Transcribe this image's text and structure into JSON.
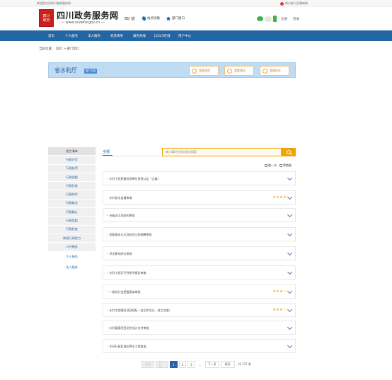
{
  "topbar": {
    "welcome": "欢迎您访问四川政务服务网",
    "login_link": "四川省人民政府网"
  },
  "header": {
    "seal_text": "四川政务",
    "site_title": "四川政务服务网",
    "site_url": "— www.sczwfw.gov.cn —",
    "province": "四川省",
    "site_switch": "站点切换",
    "dept_window": "部门窗口",
    "register": "注册",
    "login": "登录"
  },
  "nav": {
    "items": [
      "首页",
      "个人服务",
      "法人服务",
      "权责清单",
      "服务热线",
      "12345在线",
      "用户中心"
    ]
  },
  "breadcrumb": "当前位置： 首页 > 部门窗口",
  "banner": {
    "dept_name": "省水利厅",
    "tag": "部门介绍",
    "buttons": [
      "我要咨询",
      "我要建议",
      "我要投诉"
    ]
  },
  "sidebar": {
    "items": [
      "权力清单",
      "行政许可",
      "行政处罚",
      "行政强制",
      "行政征收",
      "行政给付",
      "行政裁决",
      "行政确认",
      "行政奖励",
      "行政检查",
      "其他行政权力",
      "公共服务"
    ],
    "extra": [
      "个人服务",
      "法人服务"
    ]
  },
  "content": {
    "tab_label": "全部",
    "search_placeholder": "输入事项名称关键字搜索",
    "filters": [
      "跑一次",
      "零跑腿"
    ],
    "items": [
      {
        "title": "水利工程质量检测单位资质认定（乙级）",
        "stars": ""
      },
      {
        "title": "水利安全监督审查",
        "stars": "★★★★"
      },
      {
        "title": "市级水文测站的审批",
        "stars": ""
      },
      {
        "title": "国家基本水文测站设立和调整审批",
        "stars": ""
      },
      {
        "title": "洪水影响评价审批",
        "stars": ""
      },
      {
        "title": "水利工程可行性研究报告审查",
        "stars": ""
      },
      {
        "title": "一般设计变更备案或审批",
        "stars": "★★★☆"
      },
      {
        "title": "水利工程建设项目招标（含初步设计、竣工验收）",
        "stars": "★★★☆"
      },
      {
        "title": "水利基建项目初步设计文件审批",
        "stars": ""
      },
      {
        "title": "不同行政区域边界水工程批准",
        "stars": ""
      }
    ]
  },
  "pagination": {
    "first": "首页",
    "prev": "上一页",
    "pages": [
      "1",
      "2",
      "3"
    ],
    "ellipsis": "...",
    "next": "下一页",
    "last": "尾页",
    "total": "共 137 条"
  }
}
